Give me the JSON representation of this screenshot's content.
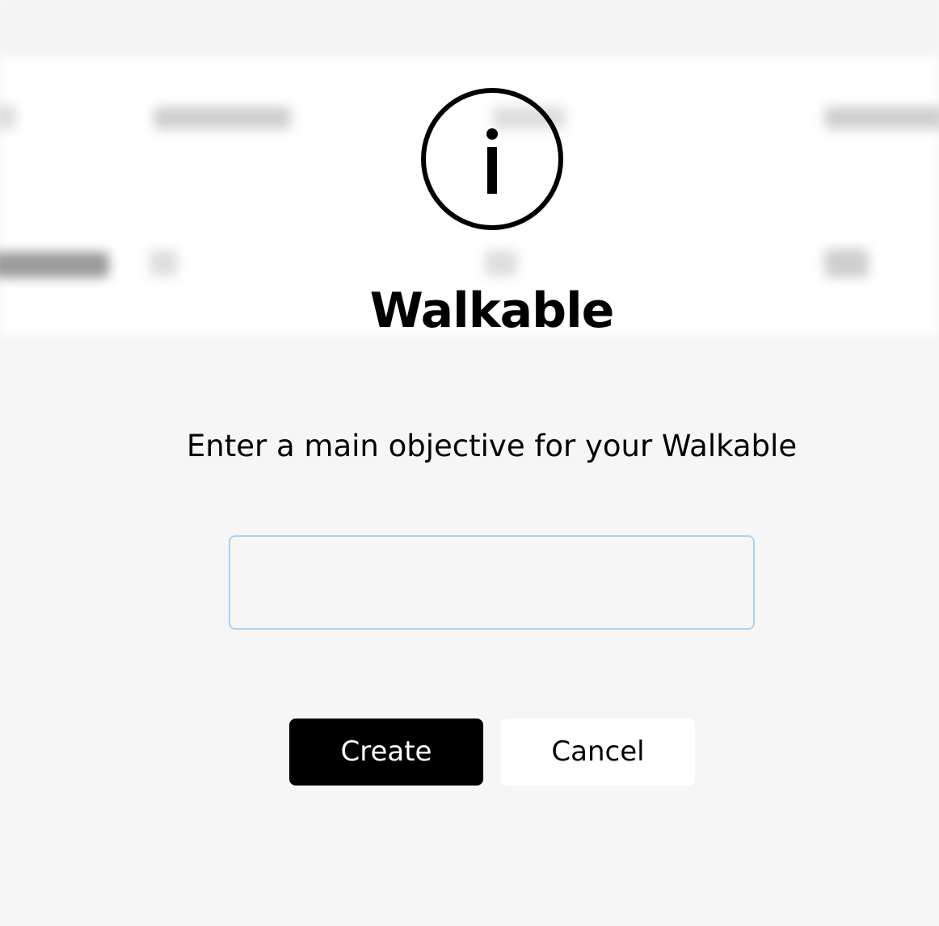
{
  "modal": {
    "icon": "info-icon",
    "title": "Walkable",
    "prompt": "Enter a main objective for your Walkable",
    "objective_input": {
      "value": "",
      "placeholder": ""
    },
    "create_label": "Create",
    "cancel_label": "Cancel"
  },
  "colors": {
    "primary_button_bg": "#000000",
    "primary_button_text": "#ffffff",
    "secondary_button_bg": "#ffffff",
    "input_border": "#a9d2ee",
    "backdrop": "#f6f6f6"
  }
}
